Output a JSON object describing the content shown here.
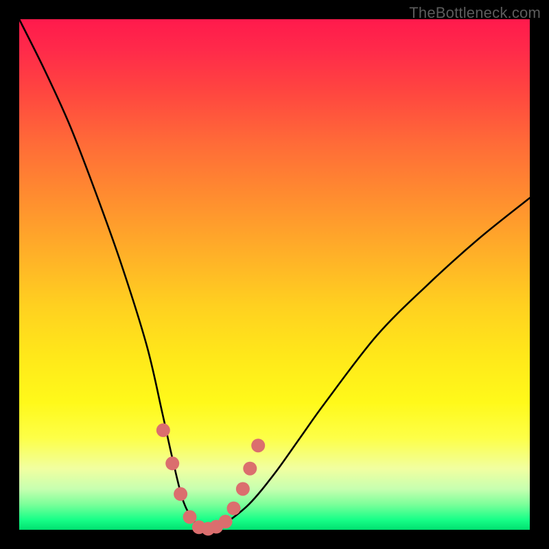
{
  "watermark": {
    "text": "TheBottleneck.com"
  },
  "chart_data": {
    "type": "line",
    "title": "",
    "xlabel": "",
    "ylabel": "",
    "xlim": [
      0,
      100
    ],
    "ylim": [
      0,
      100
    ],
    "grid": false,
    "legend": false,
    "series": [
      {
        "name": "bottleneck-curve",
        "x": [
          0,
          5,
          10,
          15,
          20,
          25,
          28,
          30,
          32,
          34,
          36,
          38,
          40,
          45,
          50,
          55,
          60,
          70,
          80,
          90,
          100
        ],
        "y": [
          100,
          90,
          79,
          66,
          52,
          36,
          23,
          14,
          6,
          2,
          0,
          0,
          1,
          5,
          11,
          18,
          25,
          38,
          48,
          57,
          65
        ]
      }
    ],
    "markers": {
      "name": "highlight-dots",
      "color": "#db6e6e",
      "x": [
        28.2,
        30.0,
        31.6,
        33.4,
        35.2,
        37.0,
        38.6,
        40.4,
        42.0,
        43.8,
        45.2,
        46.8
      ],
      "y": [
        19.5,
        13.0,
        7.0,
        2.5,
        0.5,
        0.2,
        0.6,
        1.6,
        4.2,
        8.0,
        12.0,
        16.5
      ]
    },
    "colors": {
      "curve": "#000000",
      "marker": "#db6e6e",
      "gradient_top": "#ff1a4c",
      "gradient_bottom": "#00e070"
    }
  }
}
